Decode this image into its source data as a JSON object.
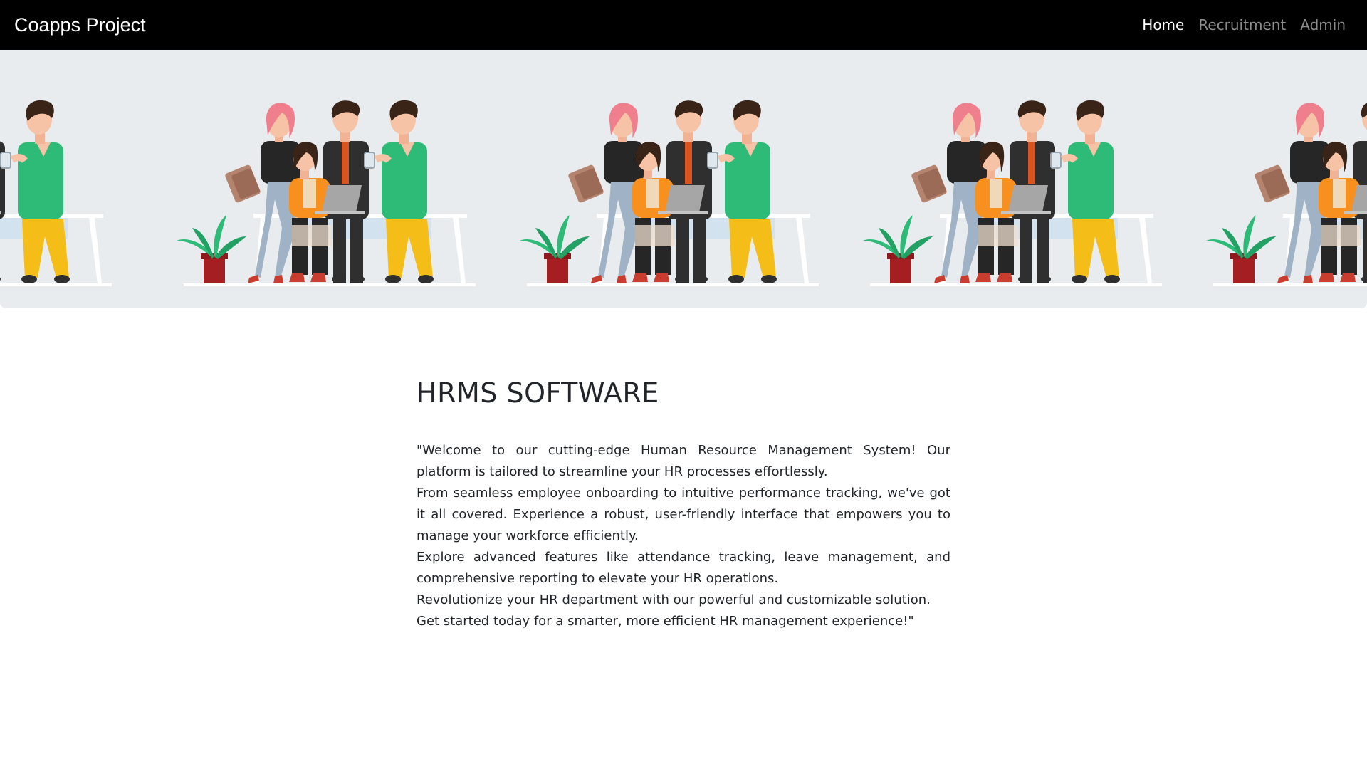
{
  "navbar": {
    "brand": "Coapps Project",
    "links": [
      {
        "label": "Home",
        "active": true
      },
      {
        "label": "Recruitment",
        "active": false
      },
      {
        "label": "Admin",
        "active": false
      }
    ]
  },
  "banner": {
    "background": "#e9ecef",
    "illustration": "team-of-office-workers-illustration"
  },
  "main": {
    "title": "HRMS SOFTWARE",
    "paragraphs": [
      "\"Welcome to our cutting-edge Human Resource Management System! Our platform is tailored to streamline your HR processes effortlessly.",
      "From seamless employee onboarding to intuitive performance tracking, we've got it all covered. Experience a robust, user-friendly interface that empowers you to manage your workforce efficiently.",
      "Explore advanced features like attendance tracking, leave management, and comprehensive reporting to elevate your HR operations.",
      "Revolutionize your HR department with our powerful and customizable solution.",
      "Get started today for a smarter, more efficient HR management experience!\""
    ]
  },
  "colors": {
    "navbar_bg": "#000000",
    "nav_active": "#ffffff",
    "nav_inactive": "#8c8c8c",
    "text": "#212529",
    "green_shirt": "#2ebb77",
    "yellow_pants": "#f4bd17",
    "orange_shirt": "#f7901e",
    "pink_hair": "#f07f8e",
    "plant_pot": "#a51e22"
  }
}
